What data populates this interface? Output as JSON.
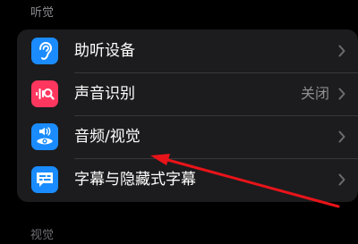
{
  "section": {
    "header": "听觉",
    "next_header": "视觉"
  },
  "rows": [
    {
      "label": "助听设备",
      "value": "",
      "icon": "ear-icon",
      "icon_bg": "#1a8cff"
    },
    {
      "label": "声音识别",
      "value": "关闭",
      "icon": "sound-recognition-icon",
      "icon_bg": "#ff375f"
    },
    {
      "label": "音频/视觉",
      "value": "",
      "icon": "speaker-eye-icon",
      "icon_bg": "#1a8cff"
    },
    {
      "label": "字幕与隐藏式字幕",
      "value": "",
      "icon": "captions-icon",
      "icon_bg": "#1a8cff"
    }
  ],
  "colors": {
    "background": "#000000",
    "group_background": "#1c1c1e",
    "annotation_arrow": "#e8141a"
  }
}
